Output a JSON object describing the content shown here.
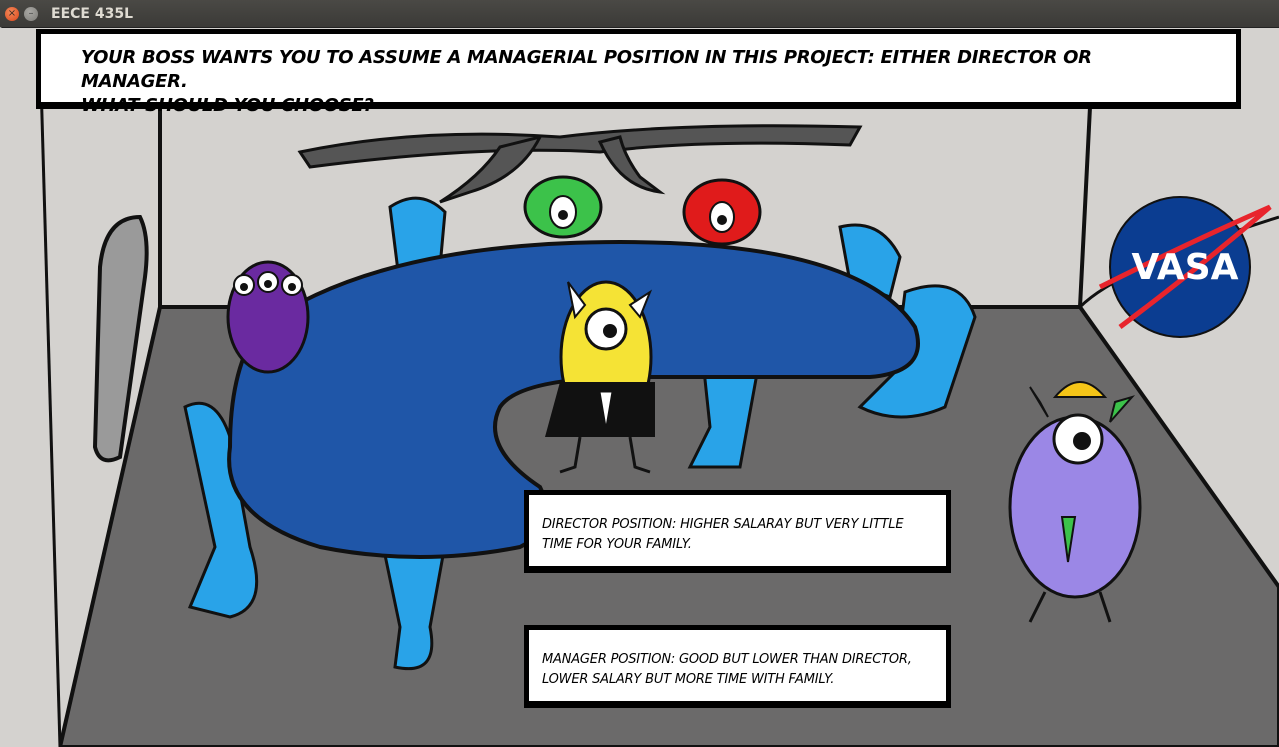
{
  "window": {
    "title": "EECE 435L",
    "close_glyph": "×",
    "minimize_glyph": "–"
  },
  "question": {
    "line1": "YOUR BOSS WANTS YOU TO ASSUME A MANAGERIAL POSITION IN THIS PROJECT: EITHER DIRECTOR OR MANAGER.",
    "line2": "WHAT SHOULD YOU CHOOSE?"
  },
  "choices": [
    {
      "text": "DIRECTOR POSITION: HIGHER SALARAY BUT VERY LITTLE TIME FOR YOUR FAMILY."
    },
    {
      "text": "MANAGER POSITION: GOOD BUT LOWER THAN DIRECTOR, LOWER SALARY BUT MORE TIME WITH FAMILY."
    }
  ],
  "logo": {
    "text": "VASA"
  },
  "colors": {
    "table": "#1f56a8",
    "chairs": "#29a3e8",
    "floor": "#6b6a6a",
    "logo_blue": "#0b3d91",
    "logo_red": "#e8242c"
  }
}
